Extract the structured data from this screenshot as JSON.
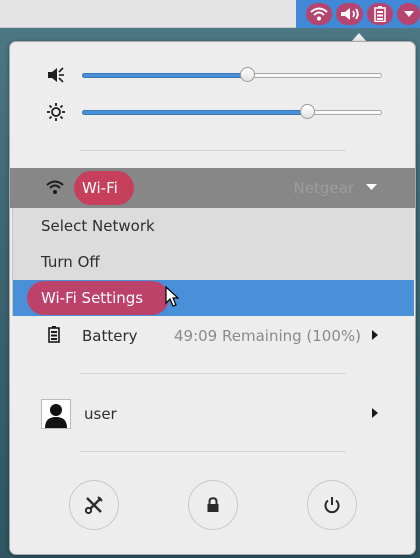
{
  "top_bar": {
    "tray_icons": [
      "wifi-icon",
      "volume-icon",
      "battery-icon"
    ],
    "menu_arrow": "chevron-down-icon",
    "accent_color": "#3f89d6",
    "highlight_color": "#d63152"
  },
  "sliders": {
    "volume": {
      "icon": "volume-low-icon",
      "level": 0.55
    },
    "brightness": {
      "icon": "brightness-icon",
      "level": 0.75
    }
  },
  "wifi": {
    "icon": "wifi-icon",
    "label": "Wi-Fi",
    "network": "Netgear",
    "menu": [
      {
        "label": "Select Network",
        "active": false
      },
      {
        "label": "Turn Off",
        "active": false
      },
      {
        "label": "Wi-Fi Settings",
        "active": true
      }
    ]
  },
  "battery": {
    "icon": "battery-icon",
    "label": "Battery",
    "status": "49:09 Remaining (100%)"
  },
  "user": {
    "icon": "avatar-icon",
    "label": "user"
  },
  "actions": [
    {
      "name": "settings-button",
      "icon": "tools-icon"
    },
    {
      "name": "lock-button",
      "icon": "lock-icon"
    },
    {
      "name": "power-button",
      "icon": "power-icon"
    }
  ]
}
